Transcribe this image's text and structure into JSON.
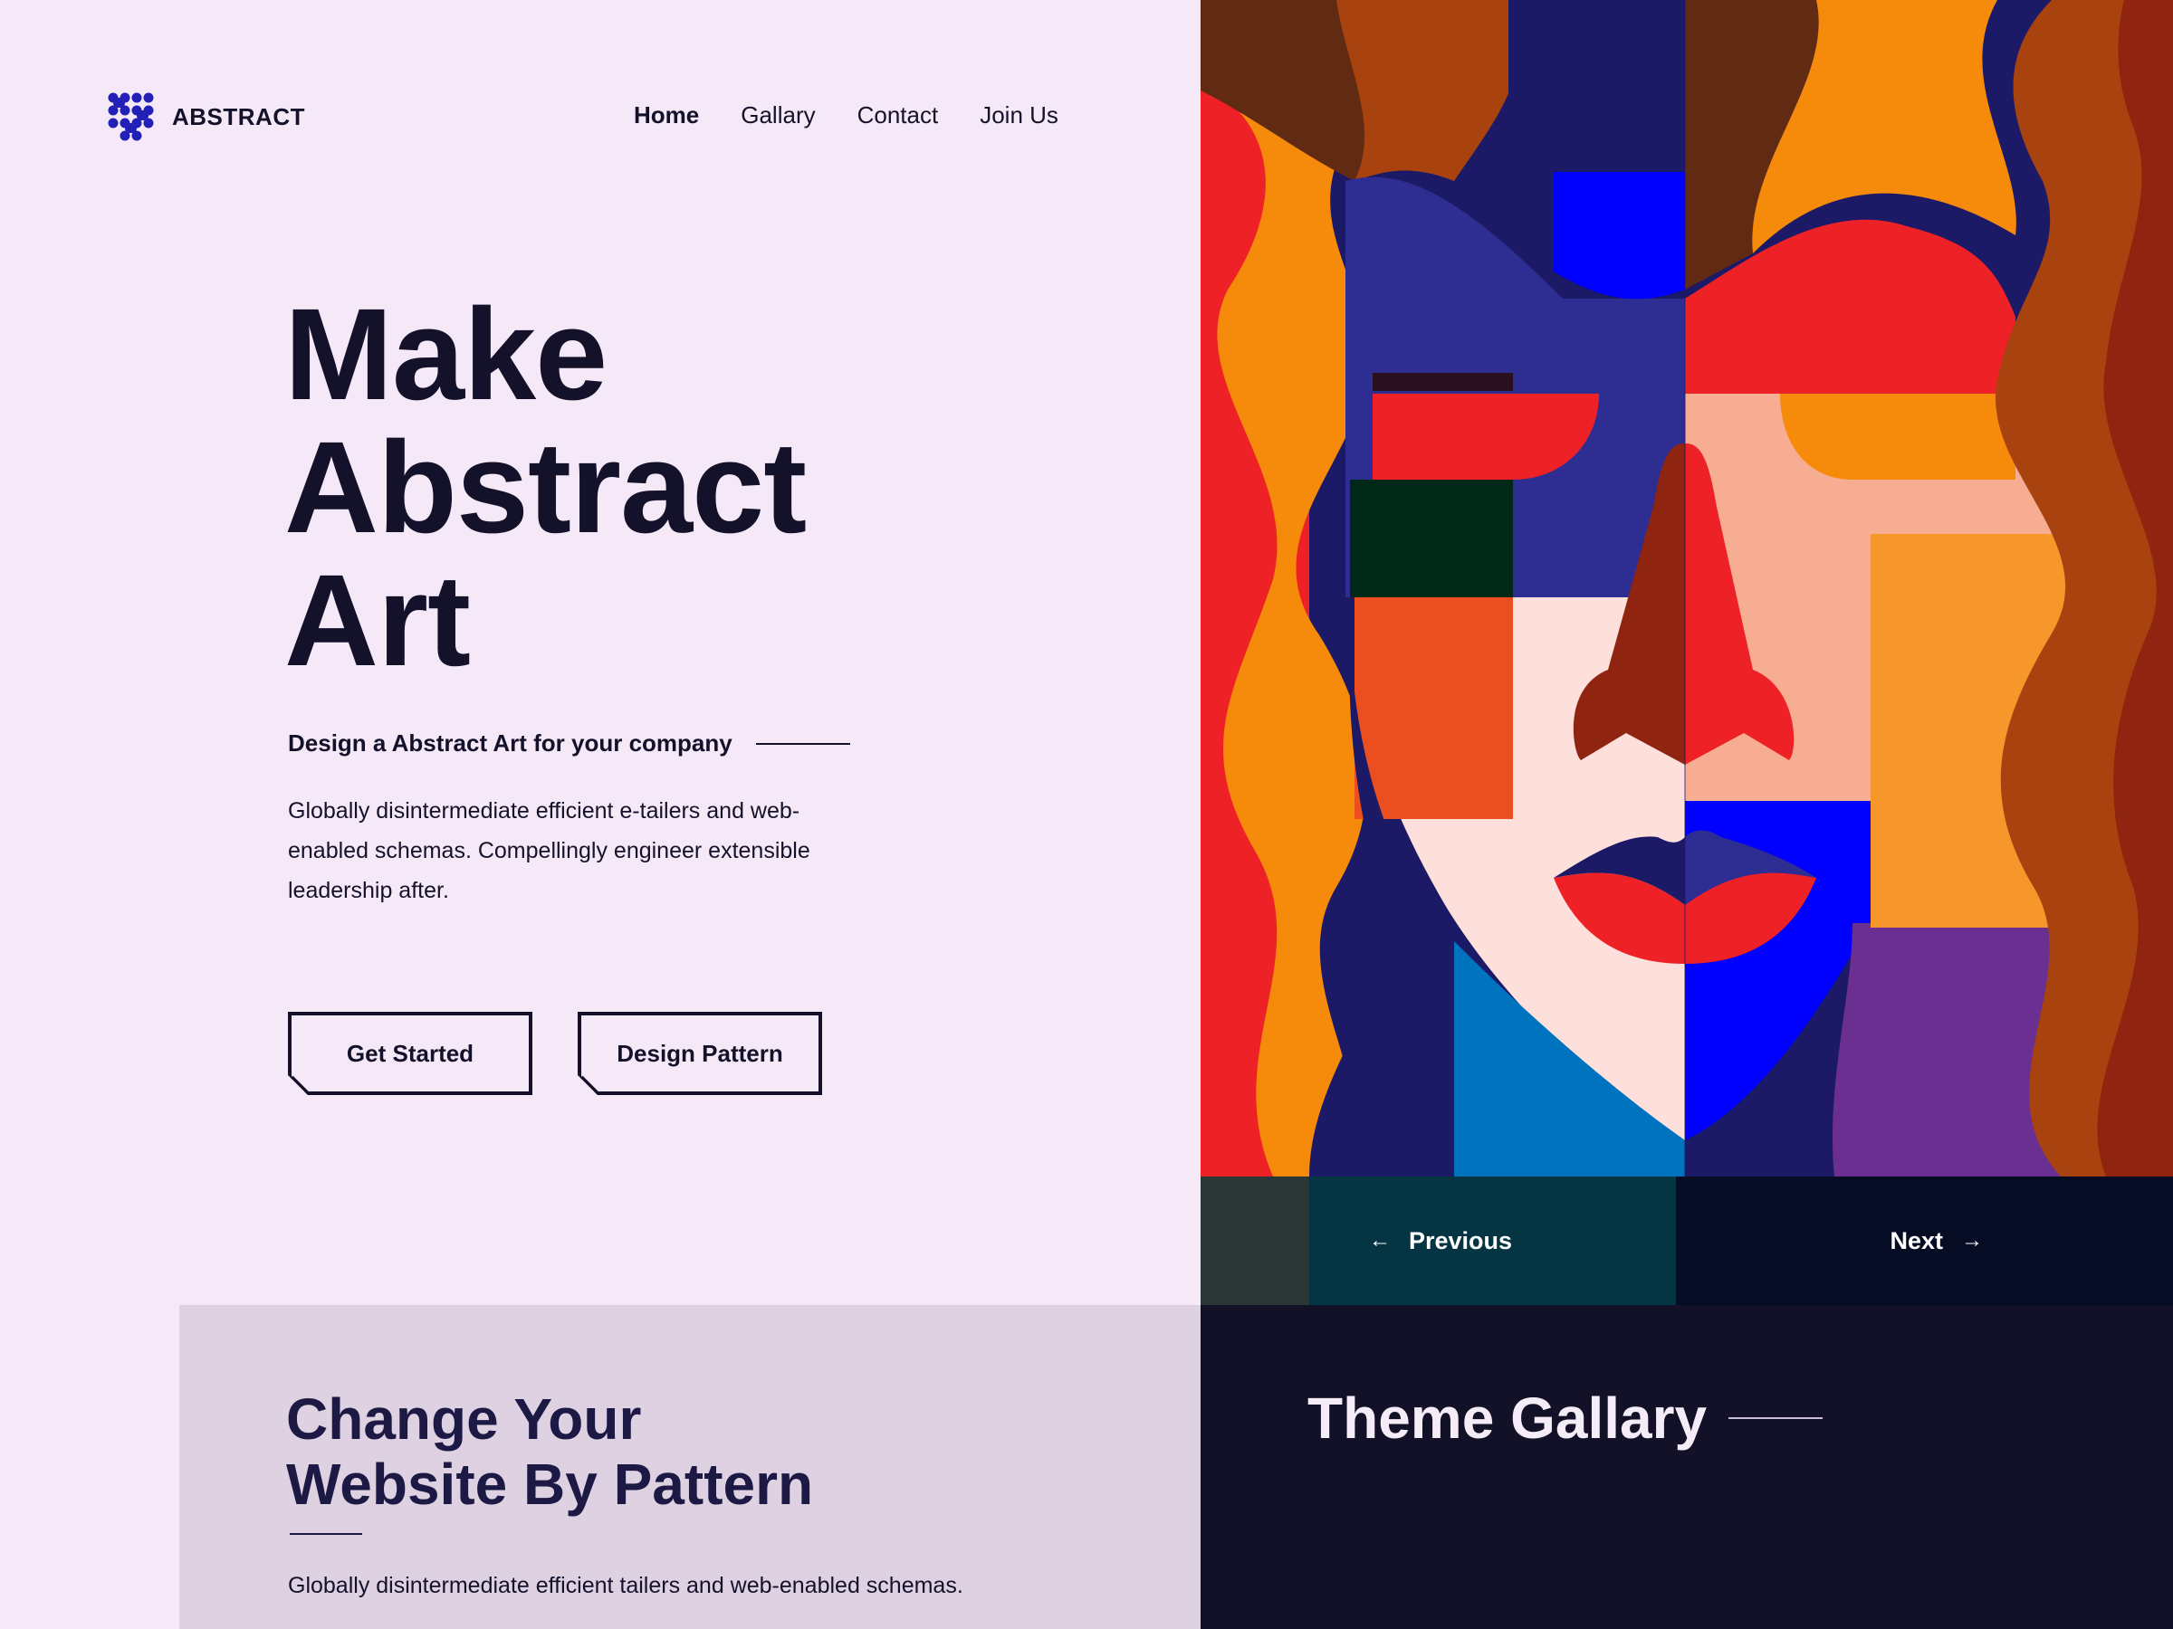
{
  "brand": {
    "name": "ABSTRACT",
    "icon": "dot-grid-logo-icon",
    "color": "#2320b8"
  },
  "nav": {
    "items": [
      {
        "label": "Home",
        "active": true
      },
      {
        "label": "Gallary",
        "active": false
      },
      {
        "label": "Contact",
        "active": false
      },
      {
        "label": "Join Us",
        "active": false
      }
    ]
  },
  "hero": {
    "title_lines": [
      "Make",
      "Abstract",
      "Art"
    ],
    "subtitle": "Design a Abstract Art for your company",
    "description": "Globally disintermediate efficient e-tailers and web-enabled schemas. Compellingly engineer extensible leadership after.",
    "buttons": {
      "primary": "Get Started",
      "secondary": "Design Pattern"
    }
  },
  "art_slider": {
    "previous_label": "Previous",
    "next_label": "Next",
    "previous_icon": "arrow-left-icon",
    "next_icon": "arrow-right-icon"
  },
  "pattern_section": {
    "title_lines": [
      "Change Your",
      "Website By Pattern"
    ],
    "text": "Globally disintermediate efficient tailers and web-enabled schemas."
  },
  "gallery_section": {
    "title": "Theme Gallary"
  },
  "colors": {
    "background": "#f6e9f7",
    "ink": "#14122b",
    "pattern_bg": "#ded1e2",
    "gallery_bg": "#121128",
    "accent_red": "#ee2226",
    "accent_orange": "#f58a0b",
    "accent_blue": "#0000ff",
    "accent_navy": "#2d2d92"
  }
}
